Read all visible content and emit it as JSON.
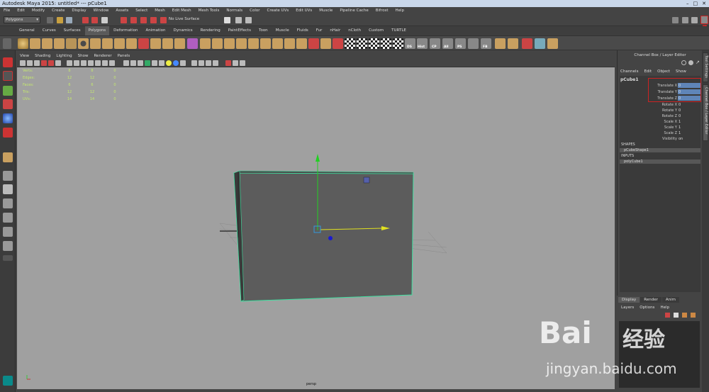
{
  "window": {
    "title": "Autodesk Maya 2015: untitled*   ---   pCube1",
    "controls": [
      "–",
      "□",
      "✕"
    ]
  },
  "menu": [
    "File",
    "Edit",
    "Modify",
    "Create",
    "Display",
    "Window",
    "Assets",
    "Select",
    "Mesh",
    "Edit Mesh",
    "Mesh Tools",
    "Normals",
    "Color",
    "Create UVs",
    "Edit UVs",
    "Muscle",
    "Pipeline Cache",
    "Bifrost",
    "Help"
  ],
  "status_line": {
    "mode": "Polygons",
    "live_surface": "No Live Surface"
  },
  "shelf_tabs": [
    "General",
    "Curves",
    "Surfaces",
    "Polygons",
    "Deformation",
    "Animation",
    "Dynamics",
    "Rendering",
    "PaintEffects",
    "Toon",
    "Muscle",
    "Fluids",
    "Fur",
    "nHair",
    "nCloth",
    "Custom",
    "TURTLE"
  ],
  "shelf_active": "Polygons",
  "shelf_labels": {
    "ds": "DS",
    "hist": "Hist",
    "cp": "CP",
    "all": "All",
    "ps": "PS",
    "fb": "FB"
  },
  "viewport": {
    "menu": [
      "View",
      "Shading",
      "Lighting",
      "Show",
      "Renderer",
      "Panels"
    ],
    "camera": "persp",
    "hud": [
      {
        "label": "Verts:",
        "a": "8",
        "b": "8",
        "c": "0"
      },
      {
        "label": "Edges:",
        "a": "12",
        "b": "12",
        "c": "0"
      },
      {
        "label": "Faces:",
        "a": "6",
        "b": "6",
        "c": "0"
      },
      {
        "label": "Tris:",
        "a": "12",
        "b": "12",
        "c": "0"
      },
      {
        "label": "UVs:",
        "a": "14",
        "b": "14",
        "c": "0"
      }
    ]
  },
  "channel_box": {
    "title": "Channel Box / Layer Editor",
    "menu": [
      "Channels",
      "Edit",
      "Object",
      "Show"
    ],
    "object": "pCube1",
    "attributes": [
      {
        "name": "Translate X",
        "value": "0",
        "highlight": true
      },
      {
        "name": "Translate Y",
        "value": "0",
        "highlight": true
      },
      {
        "name": "Translate Z",
        "value": "0",
        "highlight": true
      },
      {
        "name": "Rotate X",
        "value": "0",
        "highlight": false
      },
      {
        "name": "Rotate Y",
        "value": "0",
        "highlight": false
      },
      {
        "name": "Rotate Z",
        "value": "0",
        "highlight": false
      },
      {
        "name": "Scale X",
        "value": "1",
        "highlight": false
      },
      {
        "name": "Scale Y",
        "value": "1",
        "highlight": false
      },
      {
        "name": "Scale Z",
        "value": "1",
        "highlight": false
      },
      {
        "name": "Visibility",
        "value": "on",
        "highlight": false
      }
    ],
    "shapes_header": "SHAPES",
    "shape": "pCubeShape1",
    "inputs_header": "INPUTS",
    "input": "polyCube1"
  },
  "side_tabs": [
    "Tool Settings",
    "Channel Box / Layer Editor"
  ],
  "layer_editor": {
    "tabs": [
      "Display",
      "Render",
      "Anim"
    ],
    "active": "Display",
    "menu": [
      "Layers",
      "Options",
      "Help"
    ]
  },
  "watermark": {
    "brand": "Bai",
    "cn": "经验",
    "url": "jingyan.baidu.com"
  },
  "colors": {
    "selection": "#5f85b8",
    "wire": "#3fe0a0",
    "highlight_box": "#cc2222"
  }
}
